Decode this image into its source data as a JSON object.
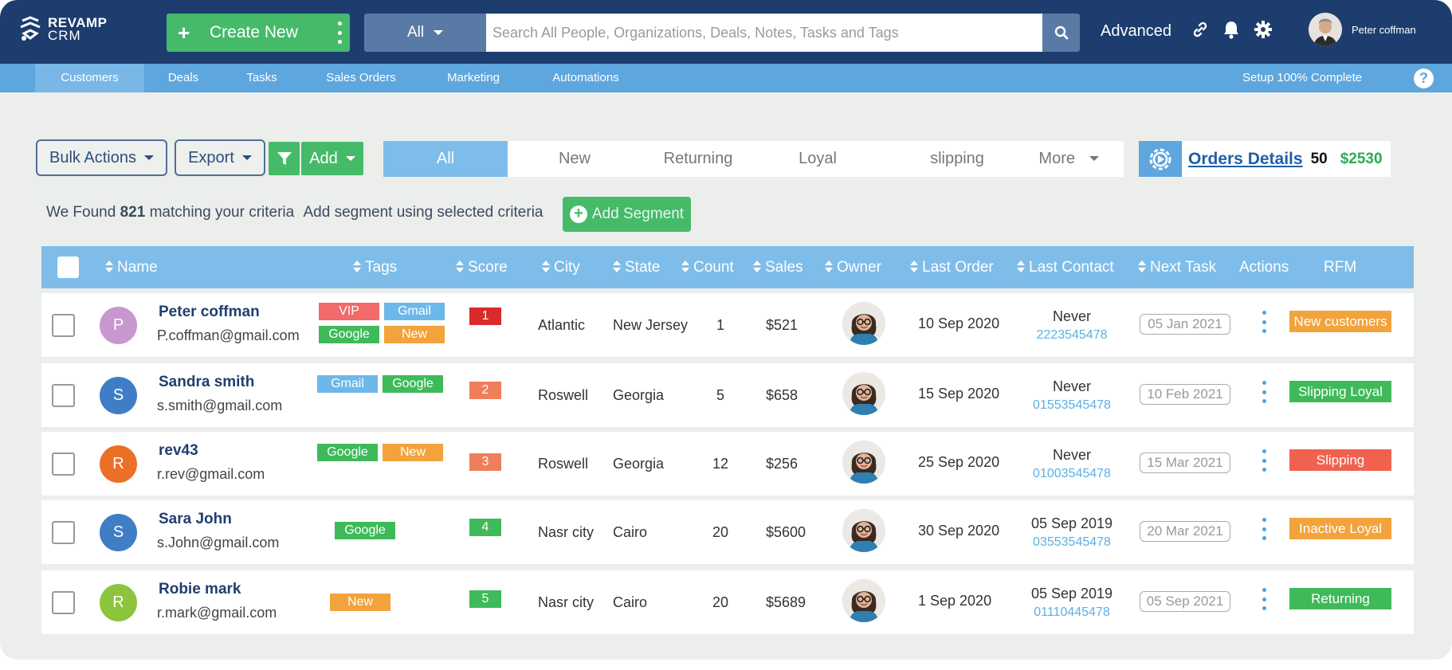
{
  "app": {
    "logo_line1": "REVAMP",
    "logo_line2": "CRM",
    "create_label": "Create New",
    "scope_label": "All",
    "search_placeholder": "Search All People, Organizations, Deals, Notes, Tasks and Tags",
    "advanced_label": "Advanced",
    "user_name": "Peter coffman"
  },
  "colors": {
    "topbar": "#1c3d6e",
    "nav": "#5ea6de",
    "accent_green": "#45bb6a",
    "header_blue": "#7ebde9"
  },
  "nav": {
    "items": [
      "Customers",
      "Deals",
      "Tasks",
      "Sales Orders",
      "Marketing",
      "Automations"
    ],
    "active": "Customers",
    "setup": "Setup 100% Complete",
    "help": "?"
  },
  "toolbar": {
    "bulk_actions": "Bulk Actions",
    "export": "Export",
    "add": "Add",
    "segments": [
      "All",
      "New",
      "Returning",
      "Loyal",
      "slipping",
      "More"
    ],
    "active_segment": "All",
    "orders_label": "Orders Details",
    "orders_count": "50",
    "orders_value": "$2530"
  },
  "summary": {
    "prefix": "We Found",
    "count": "821",
    "suffix": "matching your criteria",
    "segment_text": "Add segment using selected criteria",
    "add_segment": "Add Segment"
  },
  "table": {
    "headers": [
      "Name",
      "Tags",
      "Score",
      "City",
      "State",
      "Count",
      "Sales",
      "Owner",
      "Last Order",
      "Last Contact",
      "Next Task",
      "Actions",
      "RFM"
    ],
    "rows": [
      {
        "initial": "P",
        "avatar_color": "#c897cf",
        "name": "Peter coffman",
        "email": "P.coffman@gmail.com",
        "tags": [
          "VIP",
          "Gmail",
          "Google",
          "New"
        ],
        "score": "1",
        "score_color": "#d92b2b",
        "city": "Atlantic",
        "state": "New Jersey",
        "count": "1",
        "sales": "$521",
        "last_order": "10 Sep 2020",
        "contact": "Never",
        "phone": "2223545478",
        "next_task": "05 Jan 2021",
        "rfm": "New customers",
        "rfm_color": "#f2a33c"
      },
      {
        "initial": "S",
        "avatar_color": "#3f7ec6",
        "name": "Sandra smith",
        "email": "s.smith@gmail.com",
        "tags": [
          "Gmail",
          "Google"
        ],
        "score": "2",
        "score_color": "#ee7f5a",
        "city": "Roswell",
        "state": "Georgia",
        "count": "5",
        "sales": "$658",
        "last_order": "15 Sep 2020",
        "contact": "Never",
        "phone": "01553545478",
        "next_task": "10 Feb 2021",
        "rfm": "Slipping Loyal",
        "rfm_color": "#3fba5a"
      },
      {
        "initial": "R",
        "avatar_color": "#ec6f26",
        "name": "rev43",
        "email": "r.rev@gmail.com",
        "tags": [
          "Google",
          "New"
        ],
        "score": "3",
        "score_color": "#ee7f5a",
        "city": "Roswell",
        "state": "Georgia",
        "count": "12",
        "sales": "$256",
        "last_order": "25 Sep 2020",
        "contact": "Never",
        "phone": "01003545478",
        "next_task": "15 Mar 2021",
        "rfm": "Slipping",
        "rfm_color": "#f0624f"
      },
      {
        "initial": "S",
        "avatar_color": "#3f7ec6",
        "name": "Sara John",
        "email": "s.John@gmail.com",
        "tags": [
          "Google"
        ],
        "score": "4",
        "score_color": "#3fba5a",
        "city": "Nasr city",
        "state": "Cairo",
        "count": "20",
        "sales": "$5600",
        "last_order": "30 Sep 2020",
        "contact": "05 Sep 2019",
        "phone": "03553545478",
        "next_task": "20 Mar 2021",
        "rfm": "Inactive Loyal",
        "rfm_color": "#f2a33c"
      },
      {
        "initial": "R",
        "avatar_color": "#8cc43c",
        "name": "Robie mark",
        "email": "r.mark@gmail.com",
        "tags": [
          "New"
        ],
        "score": "5",
        "score_color": "#3fba5a",
        "city": "Nasr city",
        "state": "Cairo",
        "count": "20",
        "sales": "$5689",
        "last_order": "1 Sep 2020",
        "contact": "05 Sep 2019",
        "phone": "01110445478",
        "next_task": "05 Sep 2021",
        "rfm": "Returning",
        "rfm_color": "#3fba5a"
      }
    ],
    "tag_colors": {
      "VIP": "#f26a6a",
      "Gmail": "#6db8ea",
      "Google": "#3fba5a",
      "New": "#f2a33c"
    }
  }
}
